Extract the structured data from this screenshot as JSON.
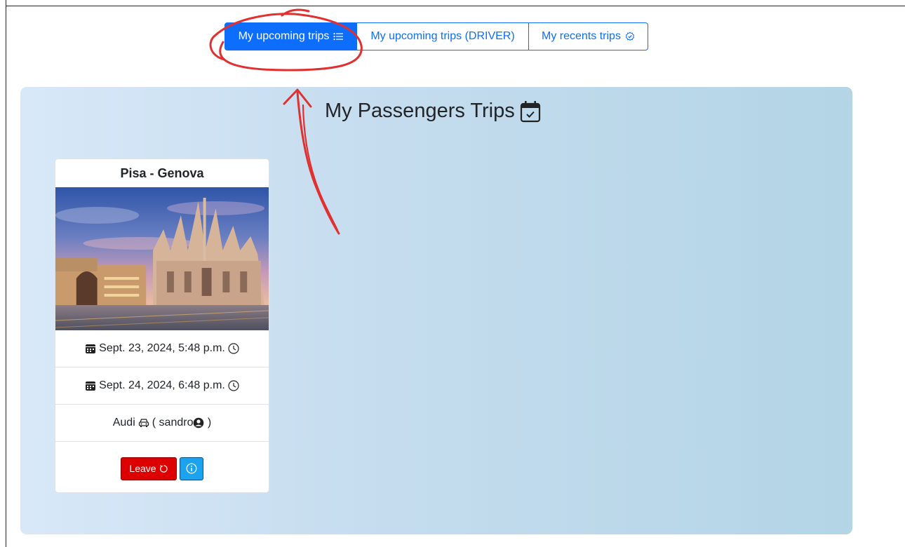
{
  "tabs": [
    {
      "label": "My upcoming trips",
      "icon": "list-icon",
      "active": true
    },
    {
      "label": "My upcoming trips (DRIVER)",
      "active": false
    },
    {
      "label": "My recents trips",
      "icon": "check-circle-icon",
      "active": false
    }
  ],
  "panel": {
    "title": "My Passengers Trips",
    "title_icon": "calendar-check-icon"
  },
  "card": {
    "route": "Pisa - Genova",
    "image": "milan-cathedral-photo",
    "departure": "Sept. 23, 2024, 5:48 p.m.",
    "arrival": "Sept. 24, 2024, 6:48 p.m.",
    "car": "Audi",
    "driver_prefix": "( sandro",
    "driver_suffix": " )",
    "leave_label": "Leave",
    "leave_color": "#dc0000",
    "info_color": "#1ca3f0"
  },
  "colors": {
    "primary": "#0d6efd",
    "annotation": "#e03030"
  }
}
